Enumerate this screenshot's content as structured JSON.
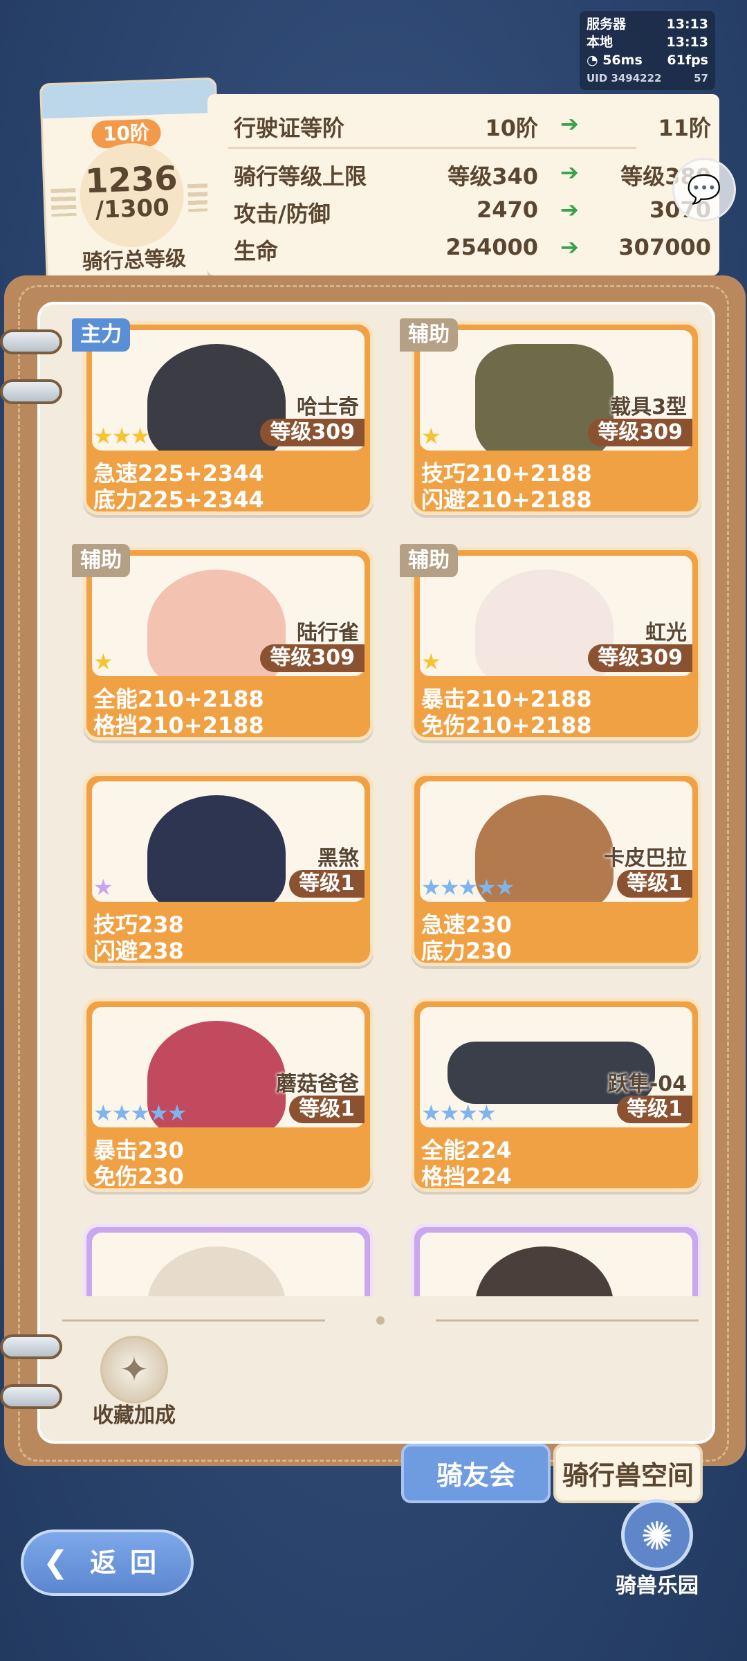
{
  "status": {
    "server_label": "服务器",
    "server_time": "13:13",
    "local_label": "本地",
    "local_time": "13:13",
    "ping": "56ms",
    "fps": "61fps",
    "uid": "UID 3494222",
    "battery": "57"
  },
  "rank": {
    "badge": "10阶",
    "current": "1236",
    "max": "/1300",
    "label": "骑行总等级"
  },
  "license": {
    "rows": [
      {
        "label": "行驶证等阶",
        "current": "10阶",
        "next": "11阶"
      },
      {
        "label": "骑行等级上限",
        "current": "等级340",
        "next": "等级380"
      },
      {
        "label": "攻击/防御",
        "current": "2470",
        "next": "3070"
      },
      {
        "label": "生命",
        "current": "254000",
        "next": "307000"
      }
    ],
    "arrow_icon": "green-arrow-right-icon"
  },
  "mounts": [
    {
      "tag": "主力",
      "name": "哈士奇",
      "level": "等级309",
      "stars": "★★★",
      "star_color": "#f6c431",
      "stat1": "急速225+2344",
      "stat2": "底力225+2344",
      "mascot_color": "#3c3c44"
    },
    {
      "tag": "辅助",
      "name": "载具3型",
      "level": "等级309",
      "stars": "★",
      "star_color": "#f6c431",
      "stat1": "技巧210+2188",
      "stat2": "闪避210+2188",
      "mascot_color": "#6e6a4a"
    },
    {
      "tag": "辅助",
      "name": "陆行雀",
      "level": "等级309",
      "stars": "★",
      "star_color": "#f6c431",
      "stat1": "全能210+2188",
      "stat2": "格挡210+2188",
      "mascot_color": "#f3c2b0"
    },
    {
      "tag": "辅助",
      "name": "虹光",
      "level": "等级309",
      "stars": "★",
      "star_color": "#f6c431",
      "stat1": "暴击210+2188",
      "stat2": "免伤210+2188",
      "mascot_color": "#f4e6e0"
    },
    {
      "tag": "",
      "name": "黑煞",
      "level": "等级1",
      "stars": "★",
      "star_color": "#c9a4f0",
      "stat1": "技巧238",
      "stat2": "闪避238",
      "mascot_color": "#2e3550"
    },
    {
      "tag": "",
      "name": "卡皮巴拉",
      "level": "等级1",
      "stars": "★★★★★",
      "star_color": "#7fb5ee",
      "stat1": "急速230",
      "stat2": "底力230",
      "mascot_color": "#b37a4d"
    },
    {
      "tag": "",
      "name": "蘑菇爸爸",
      "level": "等级1",
      "stars": "★★★★★",
      "star_color": "#7fb5ee",
      "stat1": "暴击230",
      "stat2": "免伤230",
      "mascot_color": "#c24a5e"
    },
    {
      "tag": "",
      "name": "跃隼-04",
      "level": "等级1",
      "stars": "★★★★",
      "star_color": "#7fb5ee",
      "stat1": "全能224",
      "stat2": "格挡224",
      "mascot_color": "#3a3f4a"
    }
  ],
  "bonus": {
    "label": "收藏加成",
    "icon": "sparkle-icon"
  },
  "tabs": {
    "active": "骑友会",
    "inactive": "骑行兽空间"
  },
  "back": {
    "label": "返回",
    "icon": "back-arrow-icon"
  },
  "park": {
    "label": "骑兽乐园",
    "icon": "ferris-wheel-icon"
  }
}
